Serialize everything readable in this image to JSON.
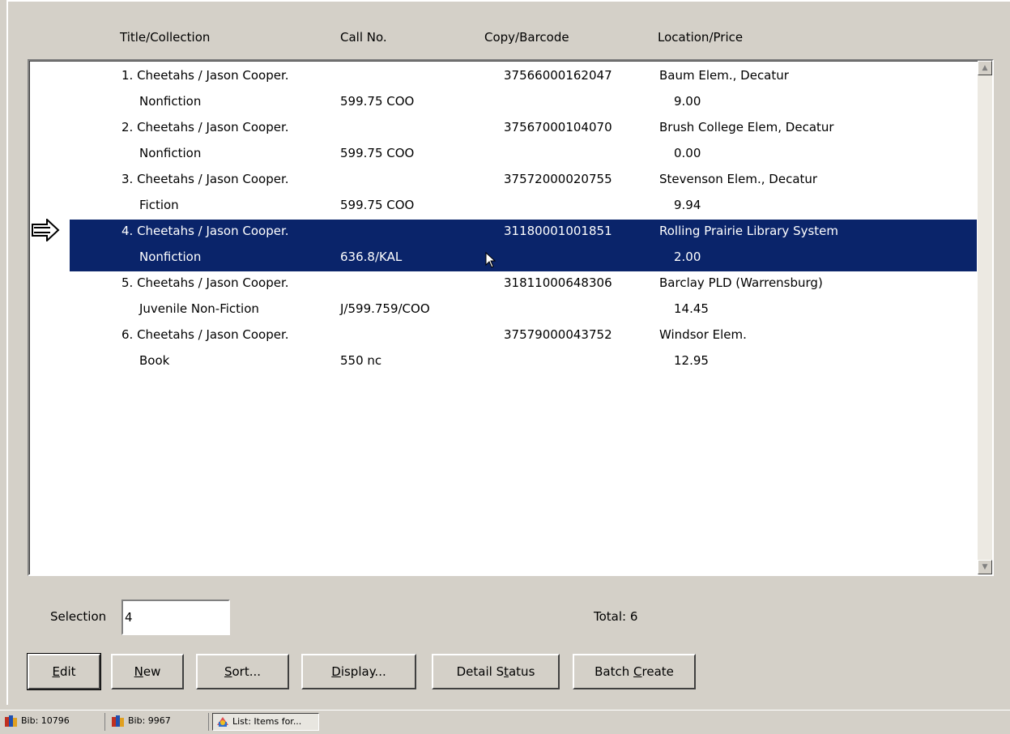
{
  "columns": {
    "title": "Title/Collection",
    "call_no": "Call No.",
    "copy": "Copy/Barcode",
    "location": "Location/Price"
  },
  "items": [
    {
      "title": "1. Cheetahs / Jason Cooper.",
      "collection": "Nonfiction",
      "call_no": "599.75 COO",
      "barcode": "37566000162047",
      "location": "Baum Elem., Decatur",
      "price": "9.00"
    },
    {
      "title": "2. Cheetahs / Jason Cooper.",
      "collection": "Nonfiction",
      "call_no": "599.75 COO",
      "barcode": "37567000104070",
      "location": "Brush College Elem, Decatur",
      "price": "0.00"
    },
    {
      "title": "3. Cheetahs / Jason Cooper.",
      "collection": "Fiction",
      "call_no": "599.75 COO",
      "barcode": "37572000020755",
      "location": "Stevenson Elem., Decatur",
      "price": "9.94"
    },
    {
      "title": "4. Cheetahs / Jason Cooper.",
      "collection": "Nonfiction",
      "call_no": "636.8/KAL",
      "barcode": "31180001001851",
      "location": "Rolling Prairie Library System",
      "price": "2.00"
    },
    {
      "title": "5. Cheetahs / Jason Cooper.",
      "collection": "Juvenile Non-Fiction",
      "call_no": "J/599.759/COO",
      "barcode": "31811000648306",
      "location": "Barclay PLD (Warrensburg)",
      "price": "14.45"
    },
    {
      "title": "6. Cheetahs / Jason Cooper.",
      "collection": "Book",
      "call_no": "550 nc",
      "barcode": "37579000043752",
      "location": "Windsor Elem.",
      "price": "12.95"
    }
  ],
  "selected_index": 4,
  "selection": {
    "label": "Selection",
    "value": "4"
  },
  "total": {
    "label": "Total:",
    "value": "6"
  },
  "buttons": {
    "edit": {
      "pre": "",
      "key": "E",
      "post": "dit"
    },
    "new": {
      "pre": "",
      "key": "N",
      "post": "ew"
    },
    "sort": {
      "pre": "",
      "key": "S",
      "post": "ort..."
    },
    "display": {
      "pre": "",
      "key": "D",
      "post": "isplay..."
    },
    "detail_status": {
      "pre": "Detail S",
      "key": "t",
      "post": "atus"
    },
    "batch_create": {
      "pre": "Batch ",
      "key": "C",
      "post": "reate"
    }
  },
  "taskbar": [
    {
      "label": "Bib: 10796",
      "icon": "books-icon"
    },
    {
      "label": "Bib: 9967",
      "icon": "books-icon"
    },
    {
      "label": "List: Items for...",
      "icon": "list-icon"
    }
  ],
  "colors": {
    "selection": "#0a246a",
    "face": "#d4d0c8"
  }
}
